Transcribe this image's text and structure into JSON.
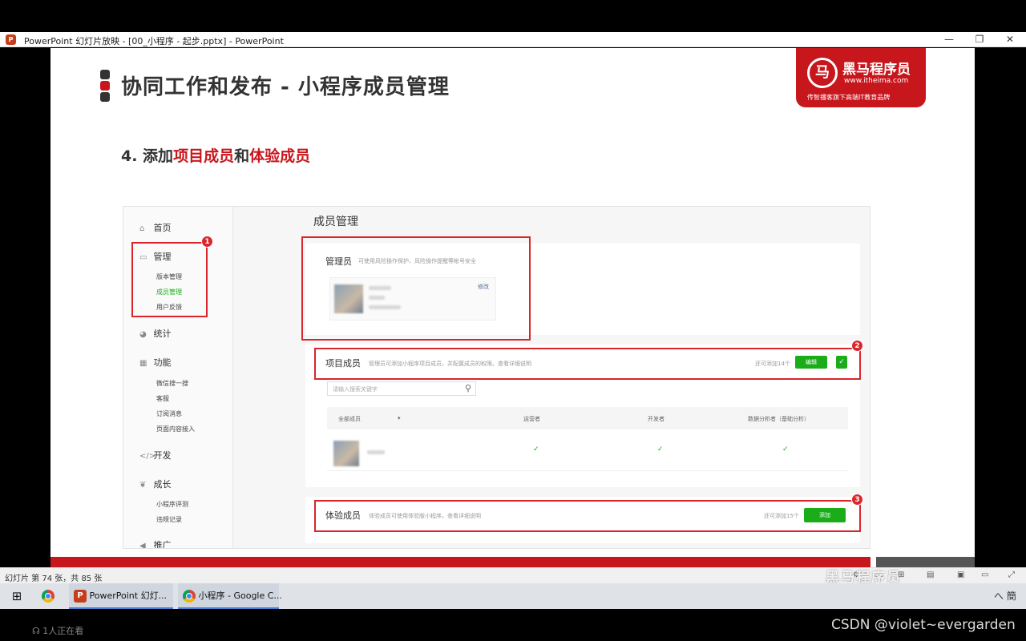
{
  "window": {
    "title": "PowerPoint 幻灯片放映 - [00_小程序 - 起步.pptx] - PowerPoint",
    "controls": {
      "minimize": "—",
      "maximize": "❐",
      "close": "✕"
    }
  },
  "slide": {
    "title": "协同工作和发布 - 小程序成员管理",
    "heading": {
      "prefix": "4. 添加",
      "part1": "项目成员",
      "middle": "和",
      "part2": "体验成员"
    },
    "logo": {
      "brand": "黑马程序员",
      "url": "www.itheima.com",
      "slogan": "传智播客旗下高端IT教育品牌"
    },
    "colors": {
      "brand_red": "#c8161d",
      "accent_green": "#1aad19"
    }
  },
  "screenshot": {
    "sidebar": {
      "main_items": [
        {
          "label": "首页",
          "icon": "home-icon"
        },
        {
          "label": "管理",
          "icon": "manage-icon"
        },
        {
          "label": "统计",
          "icon": "stats-icon"
        },
        {
          "label": "功能",
          "icon": "grid-icon"
        },
        {
          "label": "开发",
          "icon": "code-icon"
        },
        {
          "label": "成长",
          "icon": "growth-icon"
        },
        {
          "label": "推广",
          "icon": "megaphone-icon"
        }
      ],
      "manage_sub": [
        "版本管理",
        "成员管理",
        "用户反馈"
      ],
      "feature_sub": [
        "微信搜一搜",
        "客服",
        "订阅消息",
        "页面内容接入"
      ],
      "growth_sub": [
        "小程序评测",
        "违规记录"
      ]
    },
    "content_title": "成员管理",
    "admin": {
      "title": "管理员",
      "desc": "可使用风险操作保护、风险操作提醒等帐号安全",
      "edit": "修改"
    },
    "project": {
      "title": "项目成员",
      "desc": "管理员可添加小程序项目成员，并配置成员的权限。查看详细说明",
      "quota": "还可添加14个",
      "edit_button": "编辑",
      "search_placeholder": "请输入搜索关键字",
      "columns": [
        "全部成员",
        "运营者",
        "开发者",
        "数据分析者（基础分析）"
      ]
    },
    "tester": {
      "title": "体验成员",
      "desc": "体验成员可使用体验版小程序。查看详细说明",
      "quota": "还可添加15个",
      "add_button": "添加"
    },
    "annotations": [
      "1",
      "2",
      "3"
    ]
  },
  "statusbar": {
    "slide_info": "幻灯片 第 74 张，共 85 张",
    "watermark": "黑马程序员"
  },
  "taskbar": {
    "items": [
      {
        "label": "PowerPoint 幻灯..."
      },
      {
        "label": "小程序 - Google C..."
      }
    ],
    "tray": "へ 簡"
  },
  "footer": {
    "viewers": "1人正在看",
    "csdn": "CSDN @violet~evergarden"
  }
}
